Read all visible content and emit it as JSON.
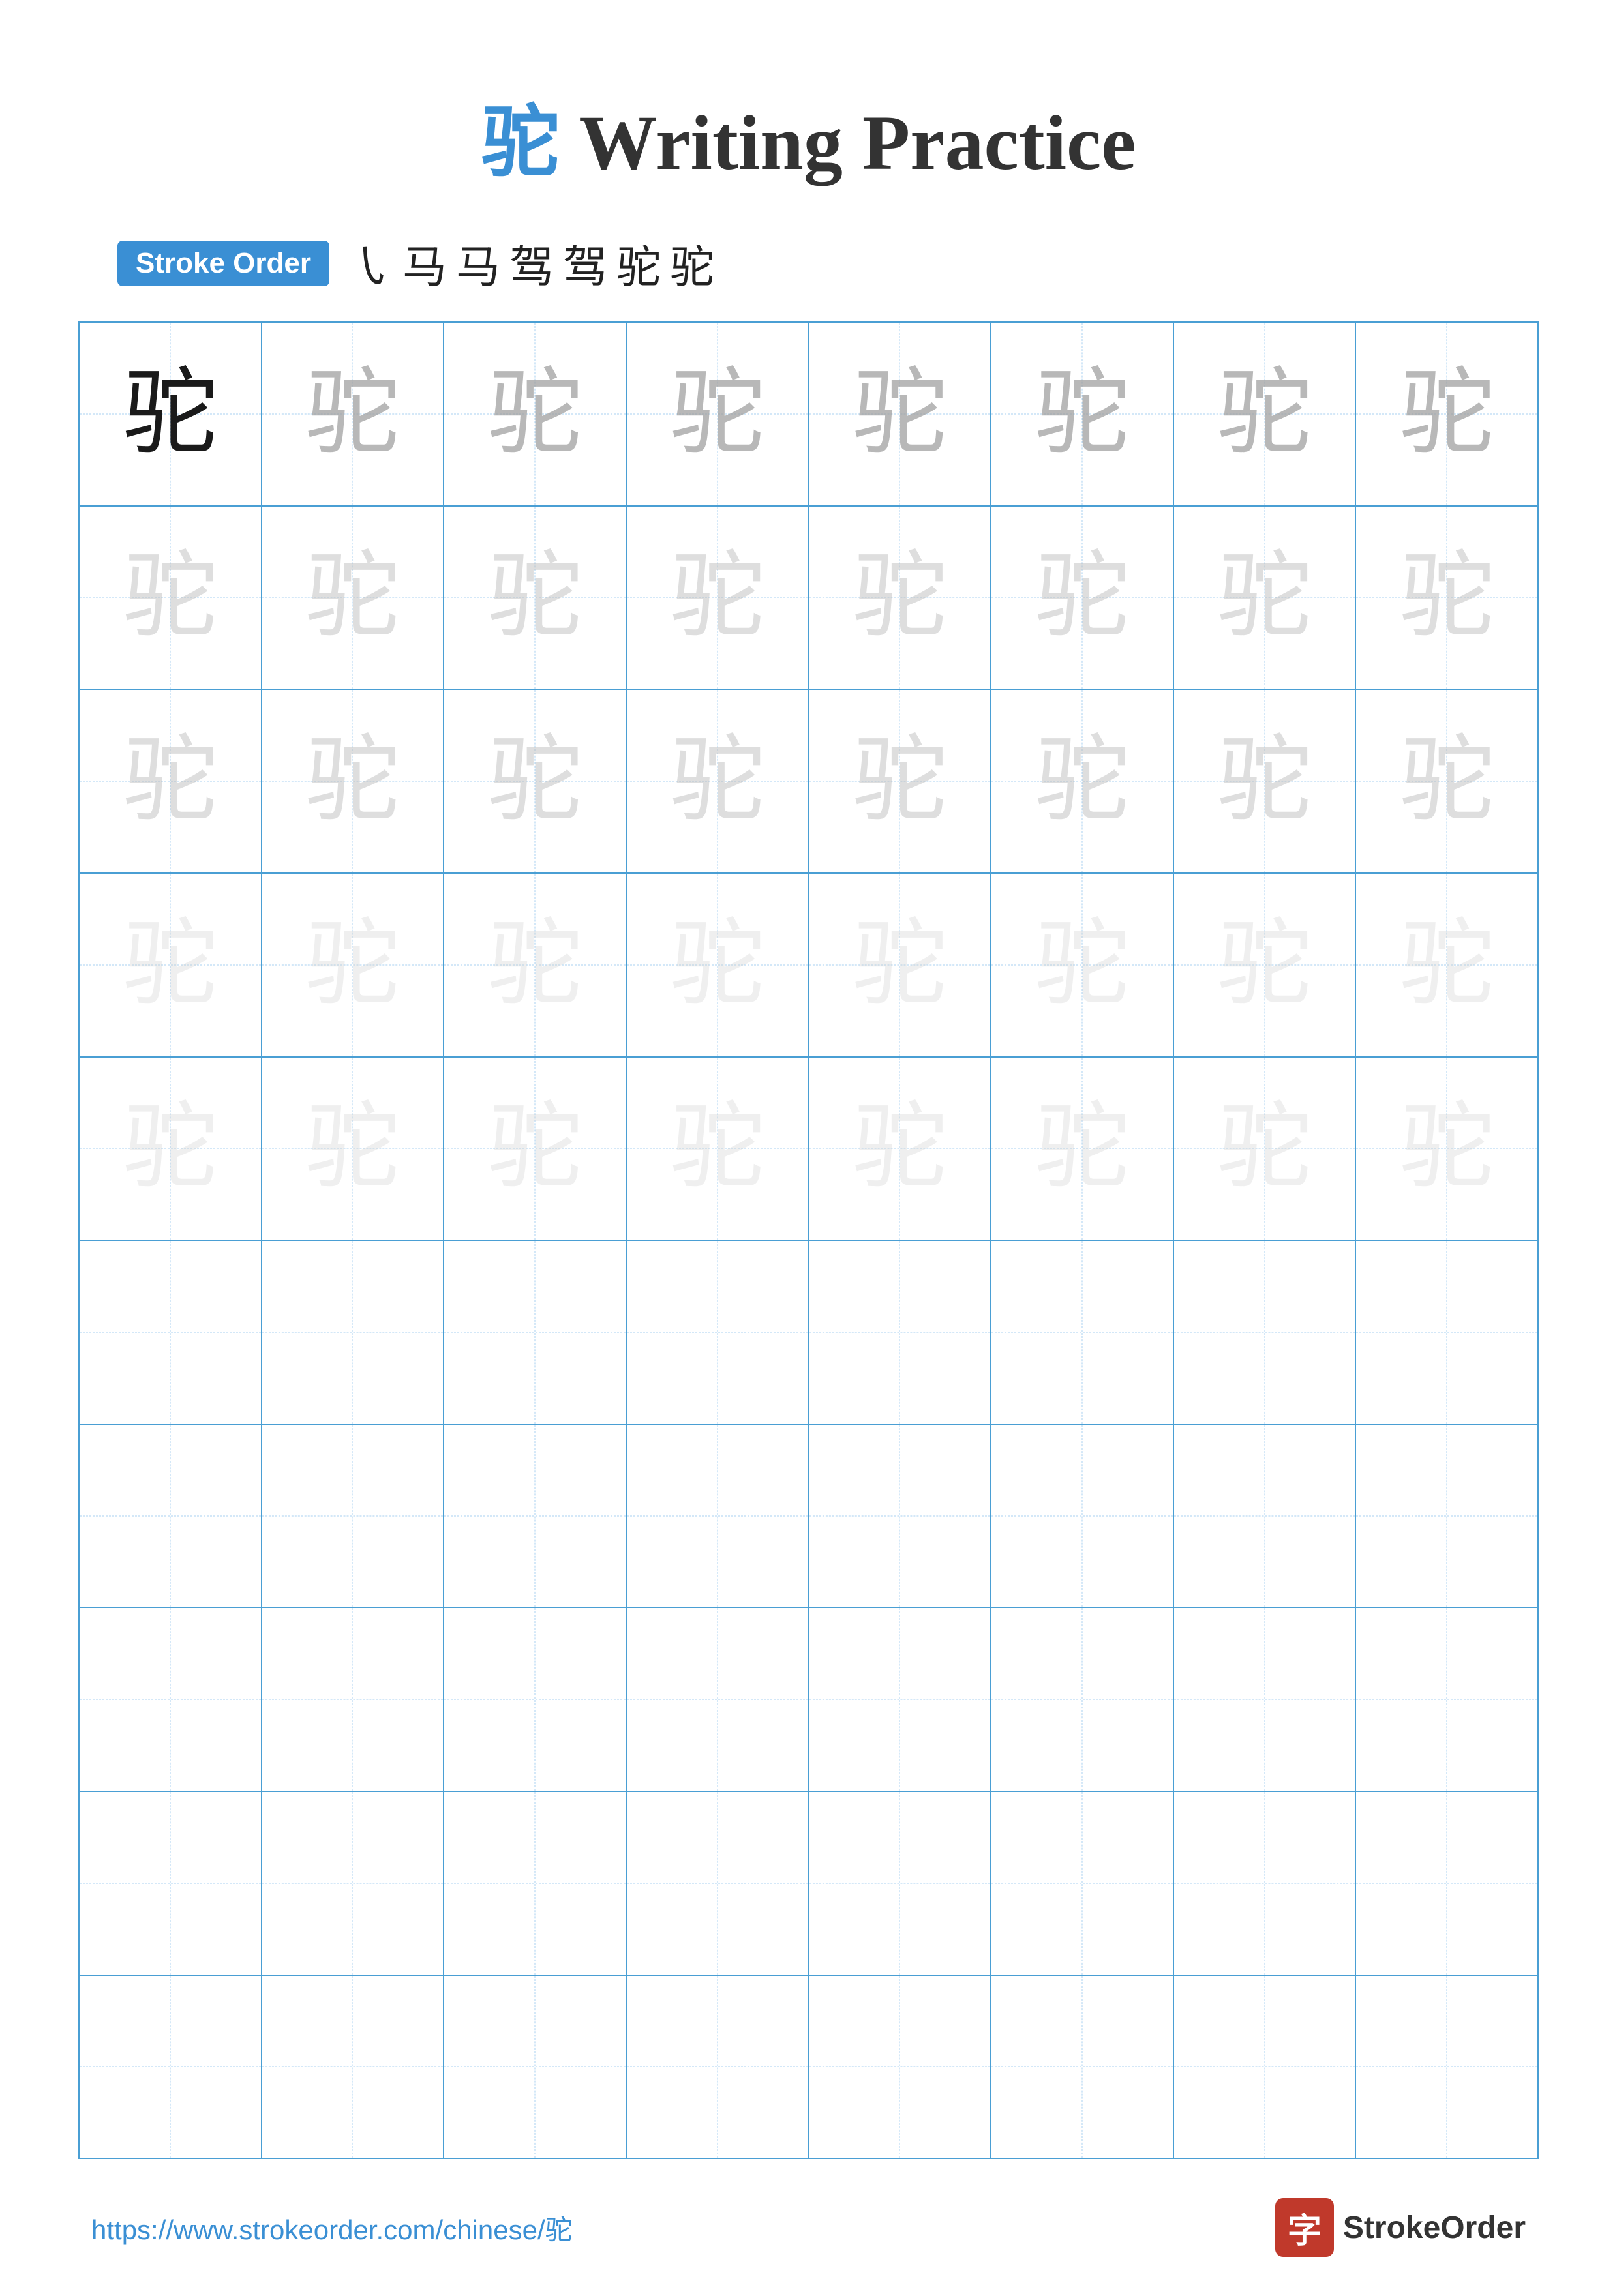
{
  "title": {
    "char": "驼",
    "text": " Writing Practice"
  },
  "stroke_order": {
    "badge_label": "Stroke Order",
    "strokes": [
      "㇂",
      "马",
      "马",
      "马`",
      "马`",
      "驼`",
      "驼"
    ]
  },
  "grid": {
    "rows": 10,
    "cols": 8,
    "char": "驼",
    "filled_rows": 5,
    "empty_rows": 5
  },
  "footer": {
    "url": "https://www.strokeorder.com/chinese/驼",
    "logo_char": "字",
    "logo_text": "StrokeOrder"
  }
}
